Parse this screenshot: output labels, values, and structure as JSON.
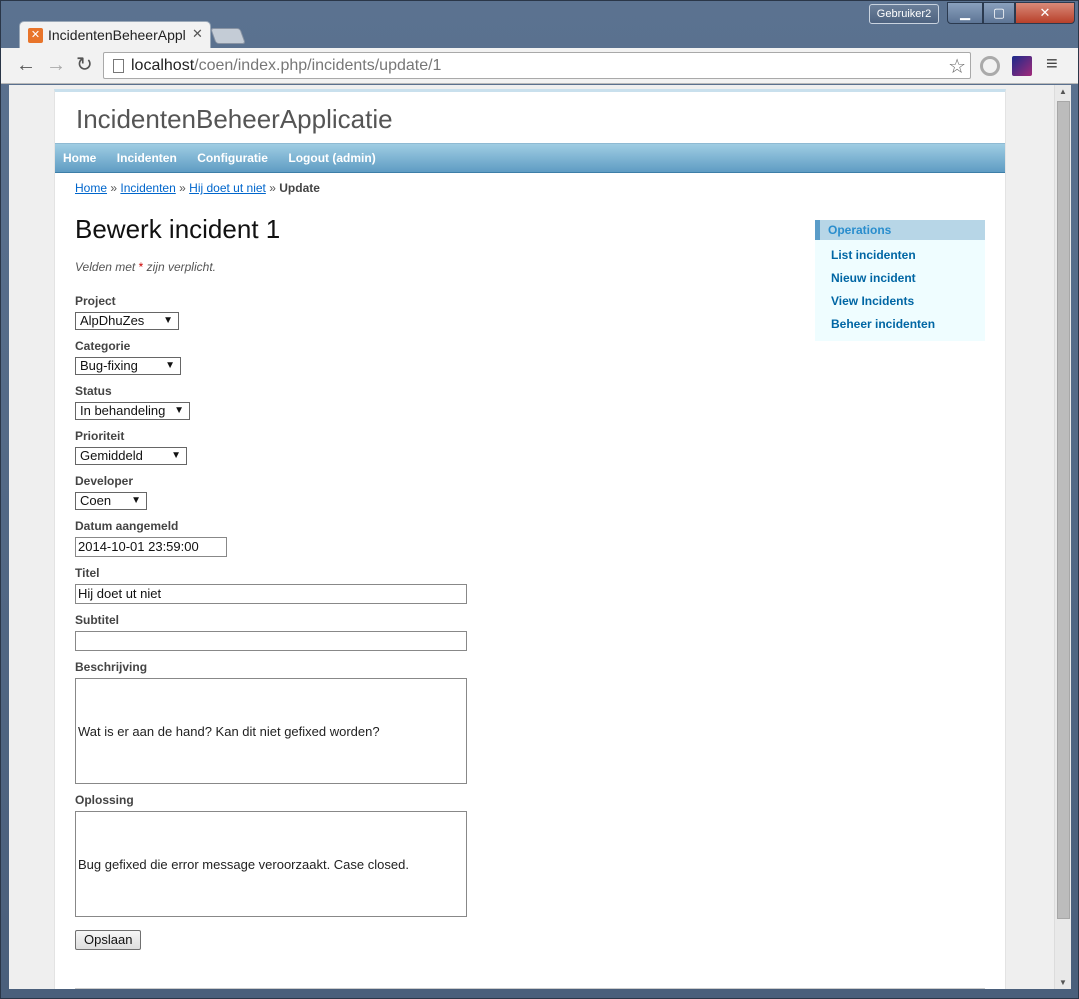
{
  "browser": {
    "user": "Gebruiker2",
    "tab_title": "IncidentenBeheerApplicatie",
    "url_host": "localhost",
    "url_path": "/coen/index.php/incidents/update/1"
  },
  "site": {
    "title": "IncidentenBeheerApplicatie",
    "menu": [
      "Home",
      "Incidenten",
      "Configuratie",
      "Logout (admin)"
    ]
  },
  "breadcrumb": {
    "items": [
      "Home",
      "Incidenten",
      "Hij doet ut niet"
    ],
    "current": "Update",
    "separator": "»"
  },
  "form": {
    "heading": "Bewerk incident 1",
    "note_prefix": "Velden met",
    "note_star": "*",
    "note_suffix": "zijn verplicht.",
    "project": {
      "label": "Project",
      "value": "AlpDhuZes"
    },
    "categorie": {
      "label": "Categorie",
      "value": "Bug-fixing"
    },
    "status": {
      "label": "Status",
      "value": "In behandeling"
    },
    "prioriteit": {
      "label": "Prioriteit",
      "value": "Gemiddeld"
    },
    "developer": {
      "label": "Developer",
      "value": "Coen"
    },
    "datum": {
      "label": "Datum aangemeld",
      "value": "2014-10-01 23:59:00"
    },
    "titel": {
      "label": "Titel",
      "value": "Hij doet ut niet"
    },
    "subtitel": {
      "label": "Subtitel",
      "value": ""
    },
    "beschrijving": {
      "label": "Beschrijving",
      "value": "Wat is er aan de hand? Kan dit niet gefixed worden?"
    },
    "oplossing": {
      "label": "Oplossing",
      "value": "Bug gefixed die error message veroorzaakt. Case closed."
    },
    "submit_label": "Opslaan"
  },
  "sidebar": {
    "title": "Operations",
    "items": [
      "List incidenten",
      "Nieuw incident",
      "View Incidents",
      "Beheer incidenten"
    ]
  }
}
